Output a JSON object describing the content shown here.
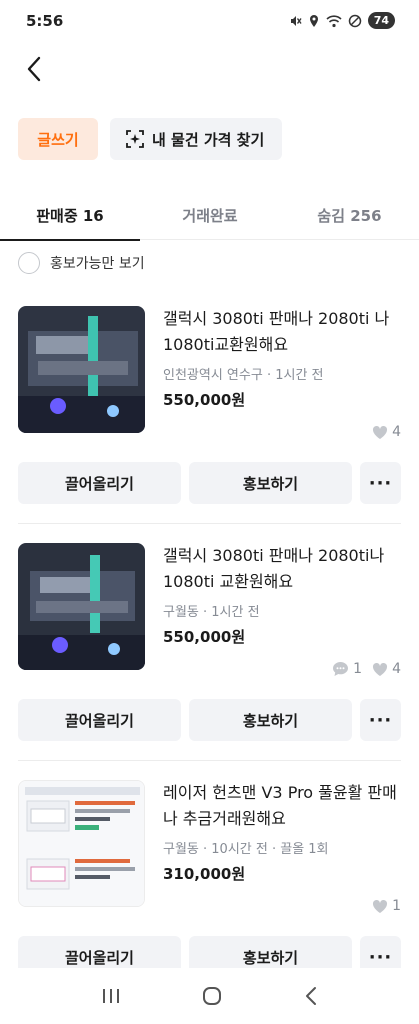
{
  "status_bar": {
    "time": "5:56",
    "battery": "74"
  },
  "header": {
    "write_label": "글쓰기",
    "price_label": "내 물건 가격 찾기"
  },
  "tabs": [
    {
      "label": "판매중 16",
      "active": true
    },
    {
      "label": "거래완료",
      "active": false
    },
    {
      "label": "숨김 256",
      "active": false
    }
  ],
  "filter": {
    "label": "홍보가능만 보기"
  },
  "items": [
    {
      "title": "갤럭시 3080ti 판매나 2080ti 나 1080ti교환원해요",
      "meta": "인천광역시 연수구 · 1시간 전",
      "price": "550,000원",
      "chats": "",
      "likes": "4",
      "bump_label": "끌어올리기",
      "promote_label": "홍보하기",
      "more_label": "···"
    },
    {
      "title": "갤럭시 3080ti 판매나 2080ti나 1080ti 교환원해요",
      "meta": "구월동 · 1시간 전",
      "price": "550,000원",
      "chats": "1",
      "likes": "4",
      "bump_label": "끌어올리기",
      "promote_label": "홍보하기",
      "more_label": "···"
    },
    {
      "title": "레이저 헌츠맨 V3 Pro 풀윤활 판매나 추금거래원해요",
      "meta": "구월동 · 10시간 전 · 끌올 1회",
      "price": "310,000원",
      "chats": "",
      "likes": "1",
      "bump_label": "끌어올리기",
      "promote_label": "홍보하기",
      "more_label": "···"
    }
  ],
  "colors": {
    "accent": "#ff6f0f",
    "accent_bg": "#fde9dd",
    "button_bg": "#f2f3f6",
    "meta": "#868b94"
  }
}
